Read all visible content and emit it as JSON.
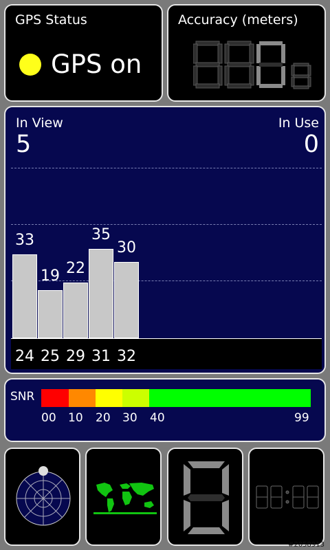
{
  "gps_status": {
    "title": "GPS Status",
    "state_text": "GPS on",
    "indicator_color": "#ffff1a"
  },
  "accuracy": {
    "title": "Accuracy (meters)",
    "display": "8880",
    "display_color": "#3a3a3a",
    "lit_color": "#8a8a8a"
  },
  "satellites": {
    "in_view_label": "In View",
    "in_view_value": "5",
    "in_use_label": "In Use",
    "in_use_value": "0",
    "bars": [
      {
        "prn": "24",
        "snr": "33"
      },
      {
        "prn": "25",
        "snr": "19"
      },
      {
        "prn": "29",
        "snr": "22"
      },
      {
        "prn": "31",
        "snr": "35"
      },
      {
        "prn": "32",
        "snr": "30"
      }
    ]
  },
  "snr": {
    "label": "SNR",
    "ticks": [
      "00",
      "10",
      "20",
      "30",
      "40",
      "99"
    ],
    "colors": [
      "#ff0000",
      "#ff8800",
      "#ffff00",
      "#ccff00",
      "#00ff00"
    ]
  },
  "bottom": {
    "compass_icon": "compass-icon",
    "map_icon": "world-map-icon",
    "digit_icon": "segment-digit-icon",
    "clock_icon": "clock-icon",
    "clock_display": "00:00"
  },
  "footer_id": "#2058913"
}
